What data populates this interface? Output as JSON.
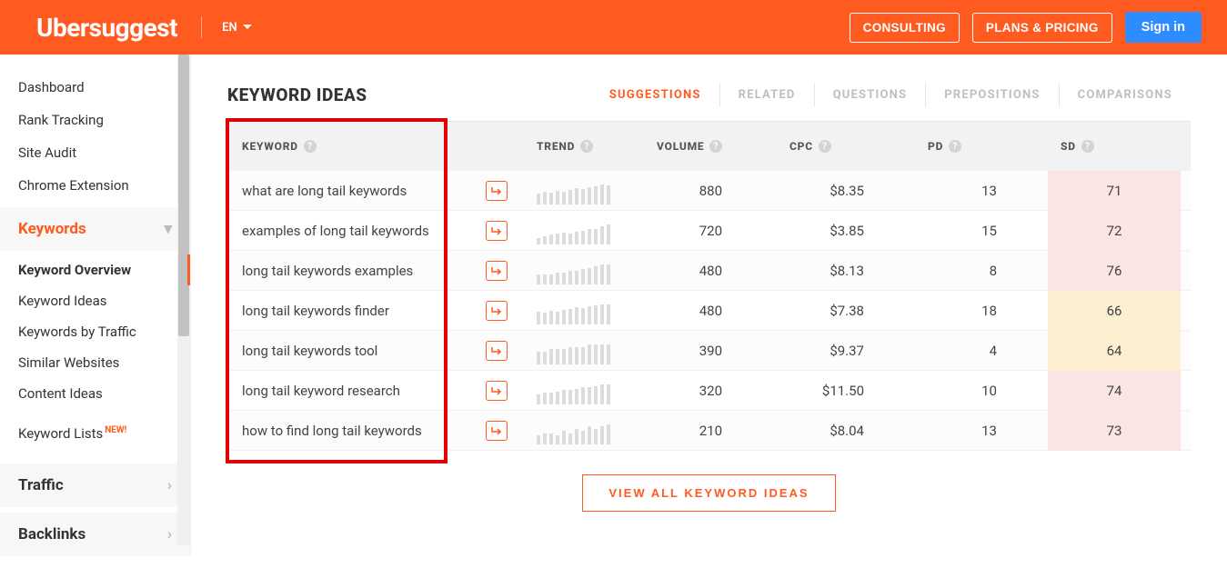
{
  "header": {
    "logo": "Ubersuggest",
    "lang": "EN",
    "consulting": "CONSULTING",
    "plans": "PLANS & PRICING",
    "signin": "Sign in"
  },
  "sidebar": {
    "top_items": [
      "Dashboard",
      "Rank Tracking",
      "Site Audit",
      "Chrome Extension"
    ],
    "keywords_section": "Keywords",
    "keywords_items": [
      "Keyword Overview",
      "Keyword Ideas",
      "Keywords by Traffic",
      "Similar Websites",
      "Content Ideas"
    ],
    "keyword_lists": "Keyword Lists",
    "new_badge": "NEW!",
    "traffic_section": "Traffic",
    "backlinks_section": "Backlinks"
  },
  "page": {
    "title": "KEYWORD IDEAS",
    "tabs": [
      "SUGGESTIONS",
      "RELATED",
      "QUESTIONS",
      "PREPOSITIONS",
      "COMPARISONS"
    ],
    "columns": {
      "keyword": "KEYWORD",
      "trend": "TREND",
      "volume": "VOLUME",
      "cpc": "CPC",
      "pd": "PD",
      "sd": "SD"
    },
    "view_all": "VIEW ALL KEYWORD IDEAS"
  },
  "rows": [
    {
      "keyword": "what are long tail keywords",
      "trend": [
        12,
        14,
        13,
        15,
        14,
        16,
        18,
        17,
        19,
        20,
        22,
        21
      ],
      "volume": "880",
      "cpc": "$8.35",
      "pd": "13",
      "sd": "71"
    },
    {
      "keyword": "examples of long tail keywords",
      "trend": [
        8,
        10,
        12,
        13,
        14,
        13,
        15,
        16,
        18,
        19,
        22,
        24
      ],
      "volume": "720",
      "cpc": "$3.85",
      "pd": "15",
      "sd": "72"
    },
    {
      "keyword": "long tail keywords examples",
      "trend": [
        6,
        6,
        6,
        7,
        7,
        8,
        8,
        9,
        10,
        11,
        12,
        12
      ],
      "volume": "480",
      "cpc": "$8.13",
      "pd": "8",
      "sd": "76"
    },
    {
      "keyword": "long tail keywords finder",
      "trend": [
        14,
        13,
        15,
        14,
        16,
        17,
        19,
        18,
        20,
        21,
        22,
        22
      ],
      "volume": "480",
      "cpc": "$7.38",
      "pd": "18",
      "sd": "66"
    },
    {
      "keyword": "long tail keywords tool",
      "trend": [
        5,
        5,
        6,
        6,
        6,
        7,
        7,
        7,
        8,
        8,
        8,
        8
      ],
      "volume": "390",
      "cpc": "$9.37",
      "pd": "4",
      "sd": "64"
    },
    {
      "keyword": "long tail keyword research",
      "trend": [
        7,
        8,
        8,
        9,
        10,
        10,
        11,
        12,
        12,
        13,
        14,
        14
      ],
      "volume": "320",
      "cpc": "$11.50",
      "pd": "10",
      "sd": "74"
    },
    {
      "keyword": "how to find long tail keywords",
      "trend": [
        4,
        5,
        5,
        4,
        6,
        5,
        7,
        6,
        8,
        7,
        8,
        9
      ],
      "volume": "210",
      "cpc": "$8.04",
      "pd": "13",
      "sd": "73"
    }
  ]
}
